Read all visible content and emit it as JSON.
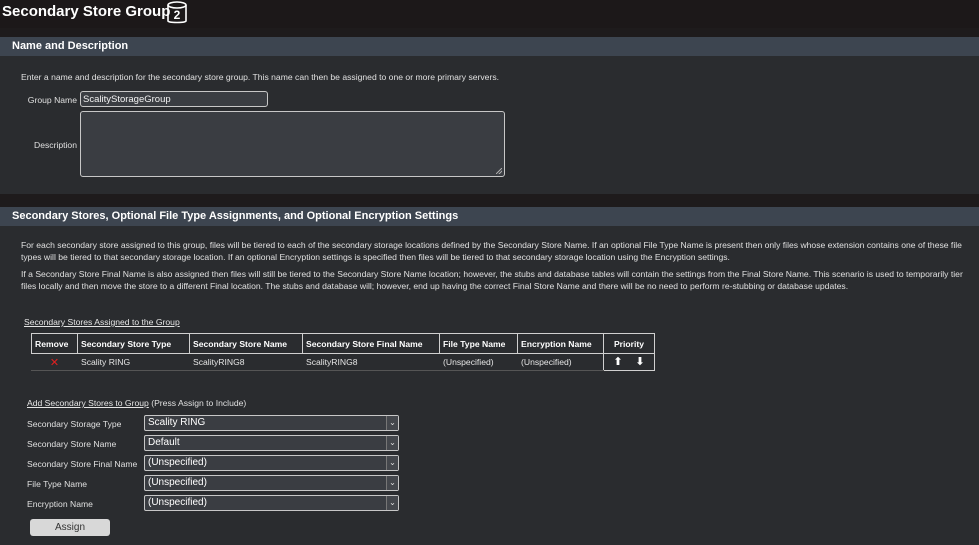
{
  "page": {
    "title": "Secondary Store Group",
    "icon": "database-2-icon"
  },
  "name_description": {
    "header": "Name and Description",
    "intro": "Enter a name and description for the secondary store group. This name can then be assigned to one or more primary servers.",
    "group_name_label": "Group Name",
    "group_name_value": "ScalityStorageGroup",
    "description_label": "Description",
    "description_value": ""
  },
  "stores": {
    "header": "Secondary Stores, Optional File Type Assignments, and Optional Encryption Settings",
    "para1": "For each secondary store assigned to this group, files will be tiered to each of the secondary storage locations defined by the Secondary Store Name. If an optional File Type Name is present then only files whose extension contains one of these file types will be tiered to that secondary storage location. If an optional Encryption settings is specified then files will be tiered to that secondary storage location using the Encryption settings.",
    "para2": "If a Secondary Store Final Name is also assigned then files will still be tiered to the Secondary Store Name location; however, the stubs and database tables will contain the settings from the Final Store Name. This scenario is used to temporarily tier files locally and then move the store to a different Final location. The stubs and database will; however, end up having the correct Final Store Name and there will be no need to perform re-stubbing or database updates.",
    "assigned_link": "Secondary Stores Assigned to the Group",
    "columns": [
      "Remove",
      "Secondary Store Type",
      "Secondary Store Name",
      "Secondary Store Final Name",
      "File Type Name",
      "Encryption Name",
      "Priority"
    ],
    "rows": [
      {
        "type": "Scality RING",
        "name": "ScalityRING8",
        "final_name": "ScalityRING8",
        "file_type": "(Unspecified)",
        "encryption": "(Unspecified)"
      }
    ],
    "add_link": "Add Secondary Stores to Group",
    "add_note": " (Press Assign to Include)",
    "form": {
      "type_label": "Secondary Storage Type",
      "type_value": "Scality RING",
      "name_label": "Secondary Store Name",
      "name_value": "Default",
      "final_label": "Secondary Store Final Name",
      "final_value": "(Unspecified)",
      "filetype_label": "File Type Name",
      "filetype_value": "(Unspecified)",
      "encryption_label": "Encryption Name",
      "encryption_value": "(Unspecified)"
    },
    "assign_button": "Assign"
  }
}
